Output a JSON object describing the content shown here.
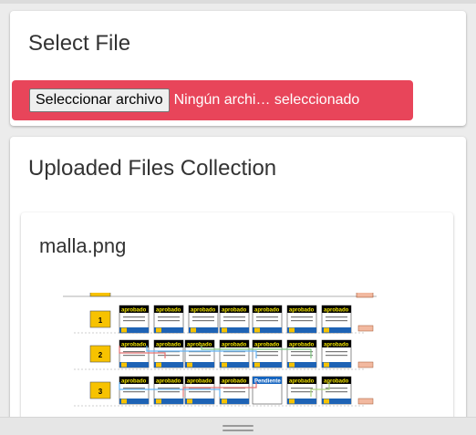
{
  "select_card": {
    "title": "Select File",
    "file_button_label": "Seleccionar archivo",
    "file_status": "Ningún archi… seleccionado"
  },
  "uploaded_card": {
    "title": "Uploaded Files Collection",
    "files": [
      {
        "name": "malla.png"
      }
    ]
  },
  "thumbnail": {
    "badge_label": "aprobado",
    "pending_label": "Pendiente",
    "row_numbers": [
      "1",
      "2",
      "3"
    ]
  },
  "colors": {
    "accent": "#e8455a",
    "badge_bg": "#000000",
    "badge_text": "#f5e600",
    "row_label": "#f7c200",
    "pending_bg": "#1565c0"
  }
}
